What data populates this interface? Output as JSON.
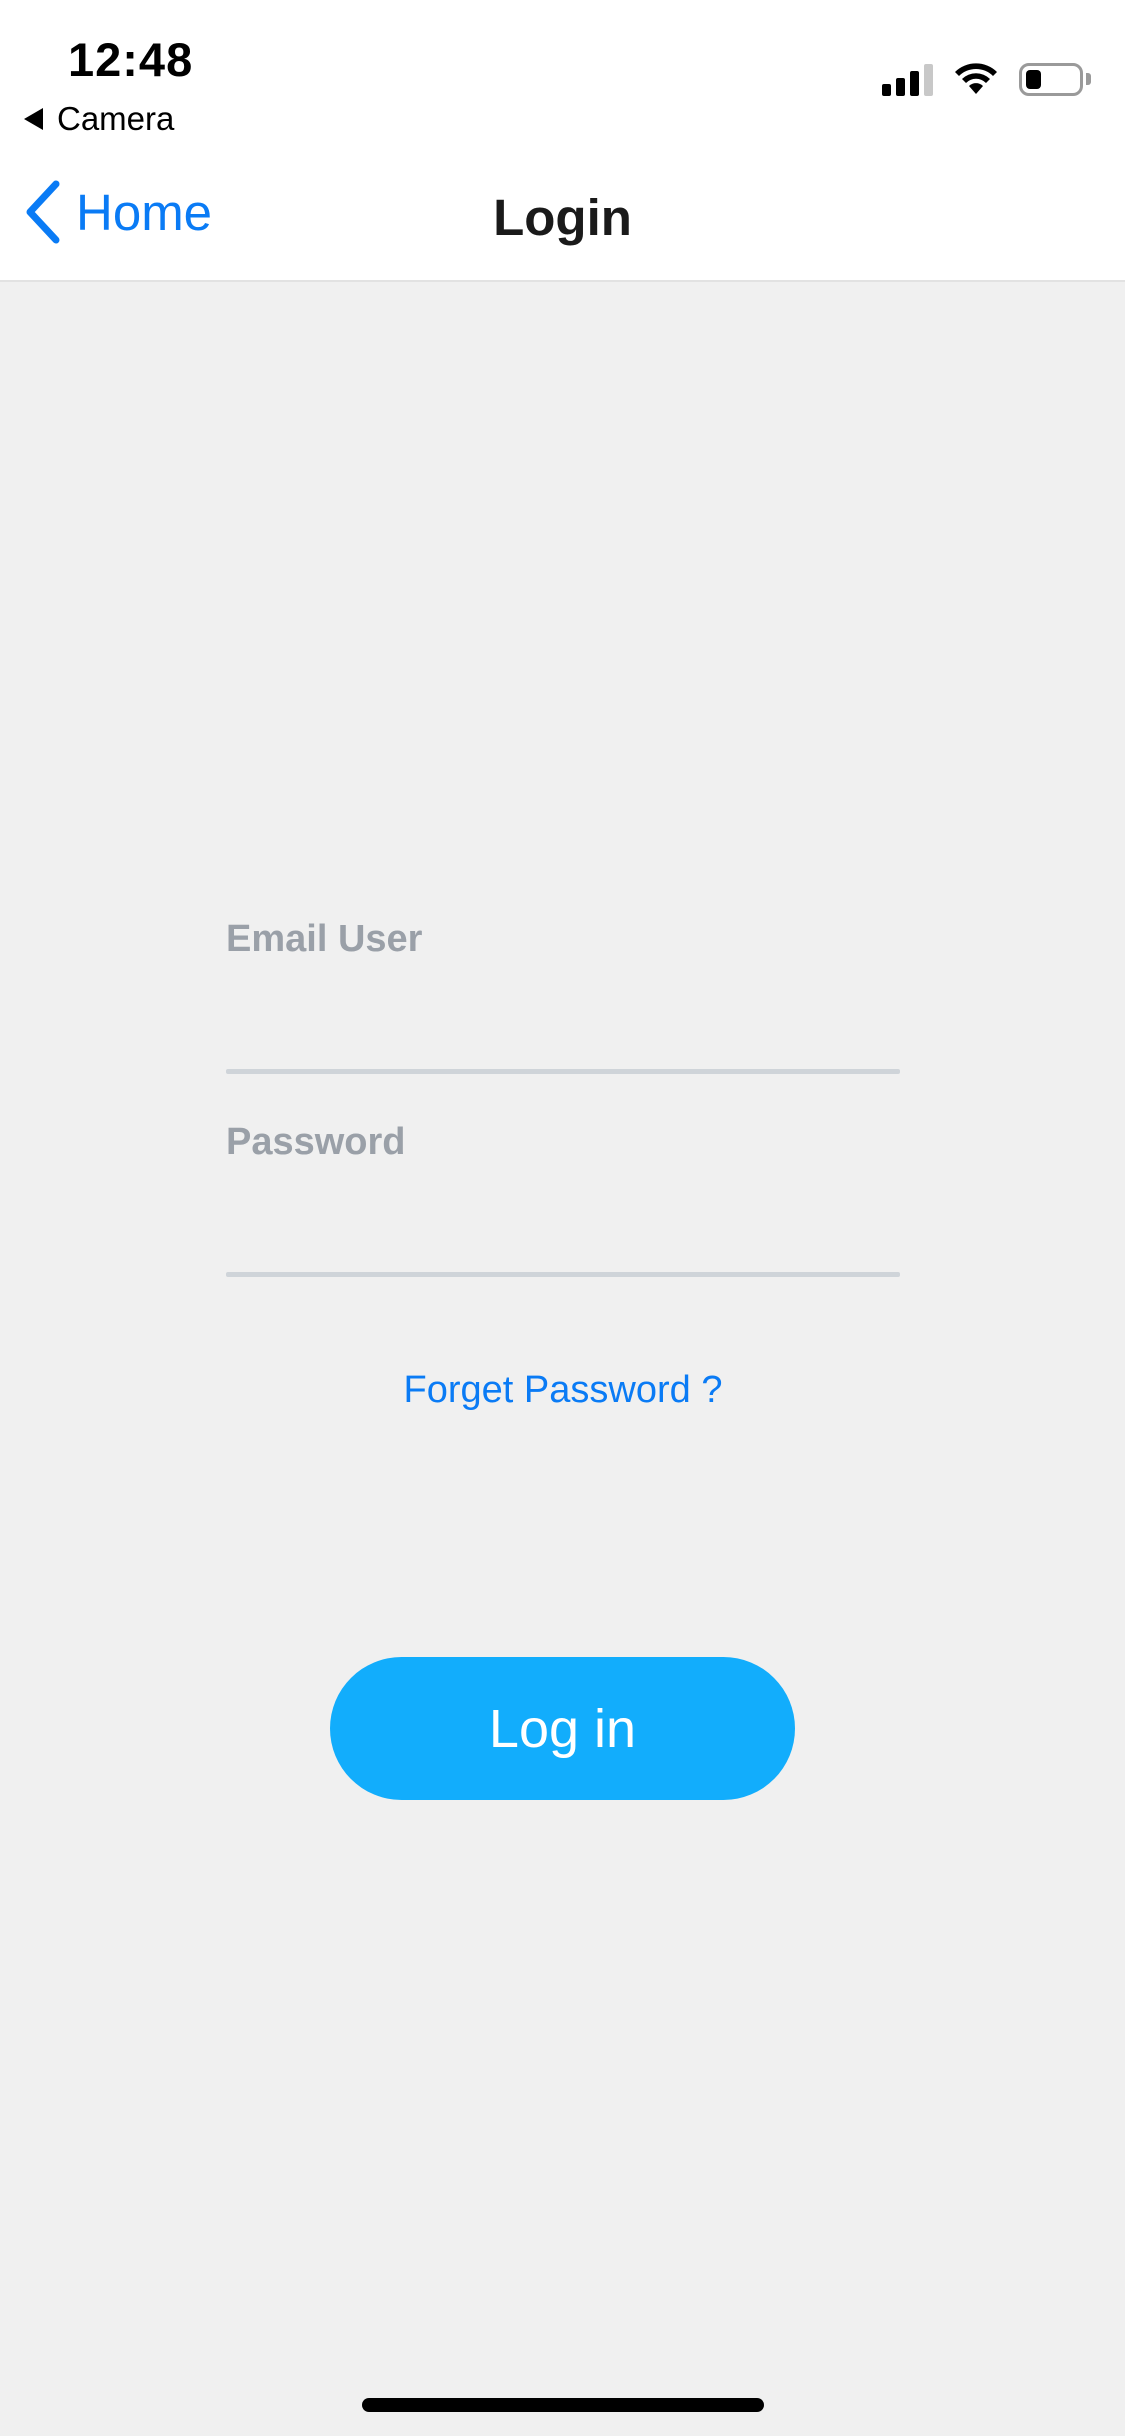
{
  "status_bar": {
    "time": "12:48",
    "back_app_label": "Camera",
    "battery_level": 0.3,
    "signal_bars": 3
  },
  "nav": {
    "back_label": "Home",
    "title": "Login"
  },
  "form": {
    "email_label": "Email User",
    "email_value": "",
    "password_label": "Password",
    "password_value": "",
    "forget_password": "Forget Password ?"
  },
  "login_button": {
    "label": "Log in"
  },
  "colors": {
    "accent_blue": "#0a7bf5",
    "button_blue": "#12adfc",
    "background": "#f0f0f0",
    "label_gray": "#9aa0a8"
  },
  "icons": {
    "back_chevron": "chevron-left-icon",
    "back_triangle": "back-triangle-icon",
    "signal": "cellular-signal-icon",
    "wifi": "wifi-icon",
    "battery": "battery-icon"
  }
}
